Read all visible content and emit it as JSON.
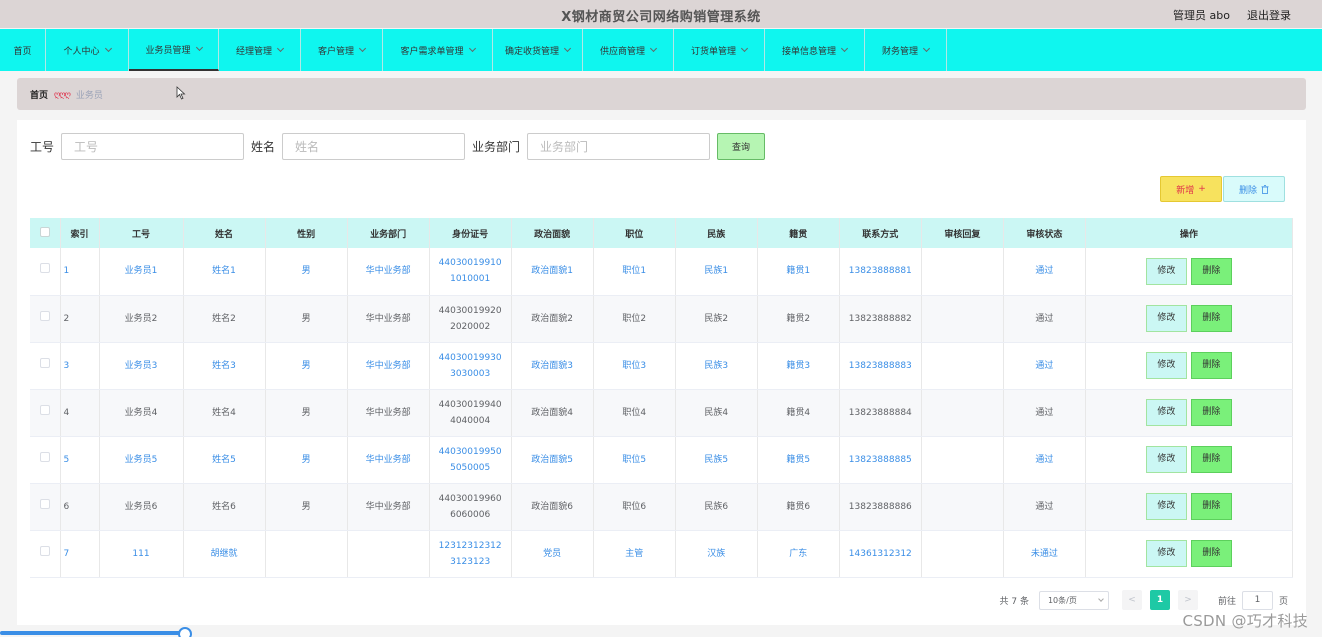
{
  "header": {
    "title": "X钢材商贸公司网络购销管理系统",
    "user": "管理员 abo",
    "logout": "退出登录"
  },
  "nav": [
    {
      "label": "首页",
      "caret": false
    },
    {
      "label": "个人中心",
      "caret": true
    },
    {
      "label": "业务员管理",
      "caret": true,
      "active": true
    },
    {
      "label": "经理管理",
      "caret": true
    },
    {
      "label": "客户管理",
      "caret": true
    },
    {
      "label": "客户需求单管理",
      "caret": true
    },
    {
      "label": "确定收货管理",
      "caret": true
    },
    {
      "label": "供应商管理",
      "caret": true
    },
    {
      "label": "订货单管理",
      "caret": true
    },
    {
      "label": "接单信息管理",
      "caret": true
    },
    {
      "label": "财务管理",
      "caret": true
    }
  ],
  "breadcrumb": {
    "home": "首页",
    "separator": "ღღღ",
    "current": "业务员"
  },
  "search": {
    "fields": [
      {
        "label": "工号",
        "placeholder": "工号"
      },
      {
        "label": "姓名",
        "placeholder": "姓名"
      },
      {
        "label": "业务部门",
        "placeholder": "业务部门"
      }
    ],
    "query_label": "查询"
  },
  "actions": {
    "add_label": "新增",
    "delete_label": "删除"
  },
  "table": {
    "columns": [
      "索引",
      "工号",
      "姓名",
      "性别",
      "业务部门",
      "身份证号",
      "政治面貌",
      "职位",
      "民族",
      "籍贯",
      "联系方式",
      "审核回复",
      "审核状态",
      "操作"
    ],
    "rows": [
      {
        "idx": "1",
        "no": "业务员1",
        "name": "姓名1",
        "sex": "男",
        "dept": "华中业务部",
        "id1": "44030019910",
        "id2": "1010001",
        "pol": "政治面貌1",
        "pos": "职位1",
        "eth": "民族1",
        "hometown": "籍贯1",
        "phone": "13823888881",
        "reply": "",
        "status": "通过"
      },
      {
        "idx": "2",
        "no": "业务员2",
        "name": "姓名2",
        "sex": "男",
        "dept": "华中业务部",
        "id1": "44030019920",
        "id2": "2020002",
        "pol": "政治面貌2",
        "pos": "职位2",
        "eth": "民族2",
        "hometown": "籍贯2",
        "phone": "13823888882",
        "reply": "",
        "status": "通过"
      },
      {
        "idx": "3",
        "no": "业务员3",
        "name": "姓名3",
        "sex": "男",
        "dept": "华中业务部",
        "id1": "44030019930",
        "id2": "3030003",
        "pol": "政治面貌3",
        "pos": "职位3",
        "eth": "民族3",
        "hometown": "籍贯3",
        "phone": "13823888883",
        "reply": "",
        "status": "通过"
      },
      {
        "idx": "4",
        "no": "业务员4",
        "name": "姓名4",
        "sex": "男",
        "dept": "华中业务部",
        "id1": "44030019940",
        "id2": "4040004",
        "pol": "政治面貌4",
        "pos": "职位4",
        "eth": "民族4",
        "hometown": "籍贯4",
        "phone": "13823888884",
        "reply": "",
        "status": "通过"
      },
      {
        "idx": "5",
        "no": "业务员5",
        "name": "姓名5",
        "sex": "男",
        "dept": "华中业务部",
        "id1": "44030019950",
        "id2": "5050005",
        "pol": "政治面貌5",
        "pos": "职位5",
        "eth": "民族5",
        "hometown": "籍贯5",
        "phone": "13823888885",
        "reply": "",
        "status": "通过"
      },
      {
        "idx": "6",
        "no": "业务员6",
        "name": "姓名6",
        "sex": "男",
        "dept": "华中业务部",
        "id1": "44030019960",
        "id2": "6060006",
        "pol": "政治面貌6",
        "pos": "职位6",
        "eth": "民族6",
        "hometown": "籍贯6",
        "phone": "13823888886",
        "reply": "",
        "status": "通过"
      },
      {
        "idx": "7",
        "no": "111",
        "name": "胡继就",
        "sex": "",
        "dept": "",
        "id1": "12312312312",
        "id2": "3123123",
        "pol": "党员",
        "pos": "主管",
        "eth": "汉族",
        "hometown": "广东",
        "phone": "14361312312",
        "reply": "",
        "status": "未通过"
      }
    ],
    "edit_label": "修改",
    "delete_label": "删除"
  },
  "pagination": {
    "total": "共 7 条",
    "page_size": "10条/页",
    "prev": "<",
    "current": "1",
    "next": ">",
    "goto_label": "前往",
    "goto_value": "1",
    "page_suffix": "页"
  },
  "watermark": "CSDN @巧才科技",
  "colors": {
    "nav_bg": "#0ff6ef",
    "header_bg": "#dcd5d5",
    "link": "#3a8ee6",
    "add_bg": "#f7e25e",
    "delete_bg": "#7af07a",
    "pager_active": "#1ec9a5"
  }
}
